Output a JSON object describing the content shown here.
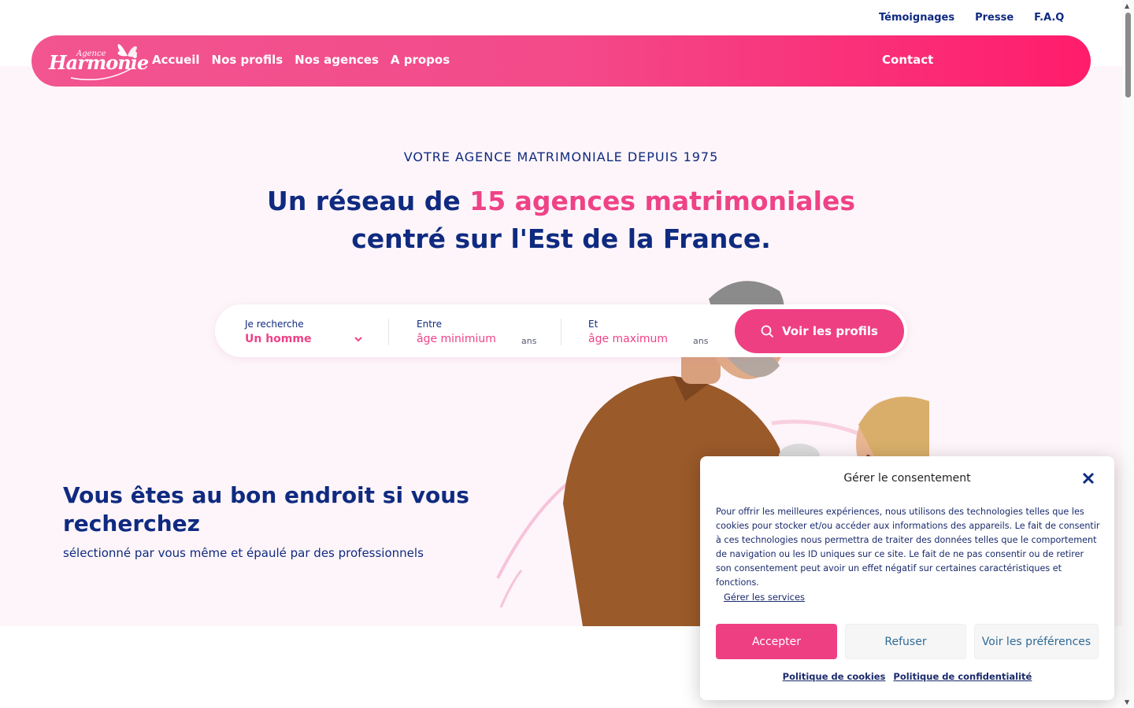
{
  "toplinks": [
    "Témoignages",
    "Presse",
    "F.A.Q"
  ],
  "logo": {
    "line1": "Agence",
    "line2": "Harmonie"
  },
  "nav": {
    "items": [
      "Accueil",
      "Nos profils",
      "Nos agences",
      "A propos"
    ],
    "contact": "Contact"
  },
  "hero": {
    "eyebrow": "VOTRE AGENCE MATRIMONIALE DEPUIS 1975",
    "headline_part1": "Un réseau de ",
    "headline_highlight": "15 agences matrimoniales",
    "headline_part2": "centré sur l'Est de la France."
  },
  "search": {
    "seeking_label": "Je recherche",
    "seeking_value": "Un homme",
    "min_label": "Entre",
    "min_placeholder": "âge minimium",
    "max_label": "Et",
    "max_placeholder": "âge maximum",
    "unit": "ans",
    "button": "Voir les profils"
  },
  "section": {
    "title": "Vous êtes au bon endroit si vous recherchez",
    "subtitle": "sélectionné par vous même et épaulé par des professionnels"
  },
  "cookie": {
    "title": "Gérer le consentement",
    "text": "Pour offrir les meilleures expériences, nous utilisons des technologies telles que les cookies pour stocker et/ou accéder aux informations des appareils. Le fait de consentir à ces technologies nous permettra de traiter des données telles que le comportement de navigation ou les ID uniques sur ce site. Le fait de ne pas consentir ou de retirer son consentement peut avoir un effet négatif sur certaines caractéristiques et fonctions.",
    "manage": "Gérer les services",
    "accept": "Accepter",
    "refuse": "Refuser",
    "preferences": "Voir les préférences",
    "cookie_policy": "Politique de cookies",
    "privacy_policy": "Politique de confidentialité"
  },
  "colors": {
    "pink": "#ef3f83",
    "navy": "#0f2a80",
    "hero_bg": "#fdf5f9"
  }
}
